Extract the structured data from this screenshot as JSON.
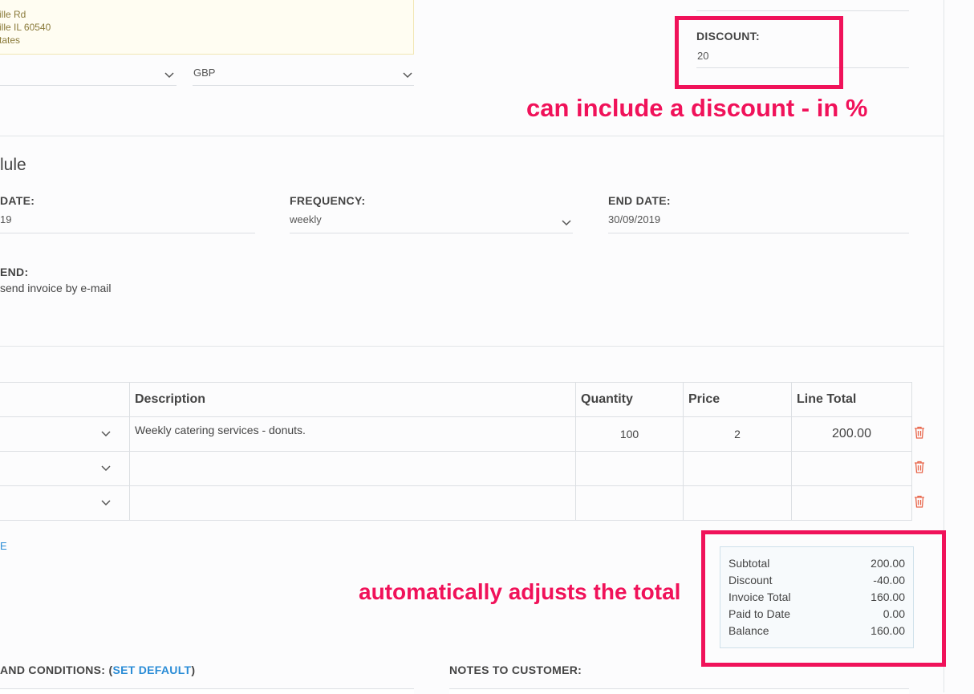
{
  "address": {
    "line1": "ille Rd",
    "line2": "ille IL 60540",
    "line3": "tates"
  },
  "currency": {
    "value": "GBP"
  },
  "discount": {
    "label": "DISCOUNT:",
    "value": "20"
  },
  "schedule": {
    "heading": "lule",
    "start_date_label": "DATE:",
    "start_date_value": "19",
    "frequency_label": "FREQUENCY:",
    "frequency_value": "weekly",
    "end_date_label": "END DATE:",
    "end_date_value": "30/09/2019",
    "send_label": "END:",
    "send_value": "send invoice by e-mail"
  },
  "line_items": {
    "headers": [
      "Description",
      "Quantity",
      "Price",
      "Line Total"
    ],
    "rows": [
      {
        "description": "Weekly catering services - donuts.",
        "quantity": "100",
        "price": "2",
        "line_total": "200.00"
      },
      {
        "description": "",
        "quantity": "",
        "price": "",
        "line_total": ""
      },
      {
        "description": "",
        "quantity": "",
        "price": "",
        "line_total": ""
      }
    ],
    "add_link": "E"
  },
  "summary": {
    "rows": [
      {
        "label": "Subtotal",
        "value": "200.00"
      },
      {
        "label": "Discount",
        "value": "-40.00"
      },
      {
        "label": "Invoice Total",
        "value": "160.00"
      },
      {
        "label": "Paid to Date",
        "value": "0.00"
      },
      {
        "label": "Balance",
        "value": "160.00"
      }
    ]
  },
  "footer": {
    "terms_label_prefix": "AND CONDITIONS: (",
    "terms_link": "SET DEFAULT",
    "terms_label_suffix": ")",
    "notes_label": "NOTES TO CUSTOMER:"
  },
  "annotations": {
    "discount_note": "can include a discount - in %",
    "total_note": "automatically adjusts the total"
  },
  "colors": {
    "highlight": "#f0125a",
    "link": "#2a8cd6",
    "trash_icon": "#e8654a",
    "address_bg": "#fffdf2"
  }
}
